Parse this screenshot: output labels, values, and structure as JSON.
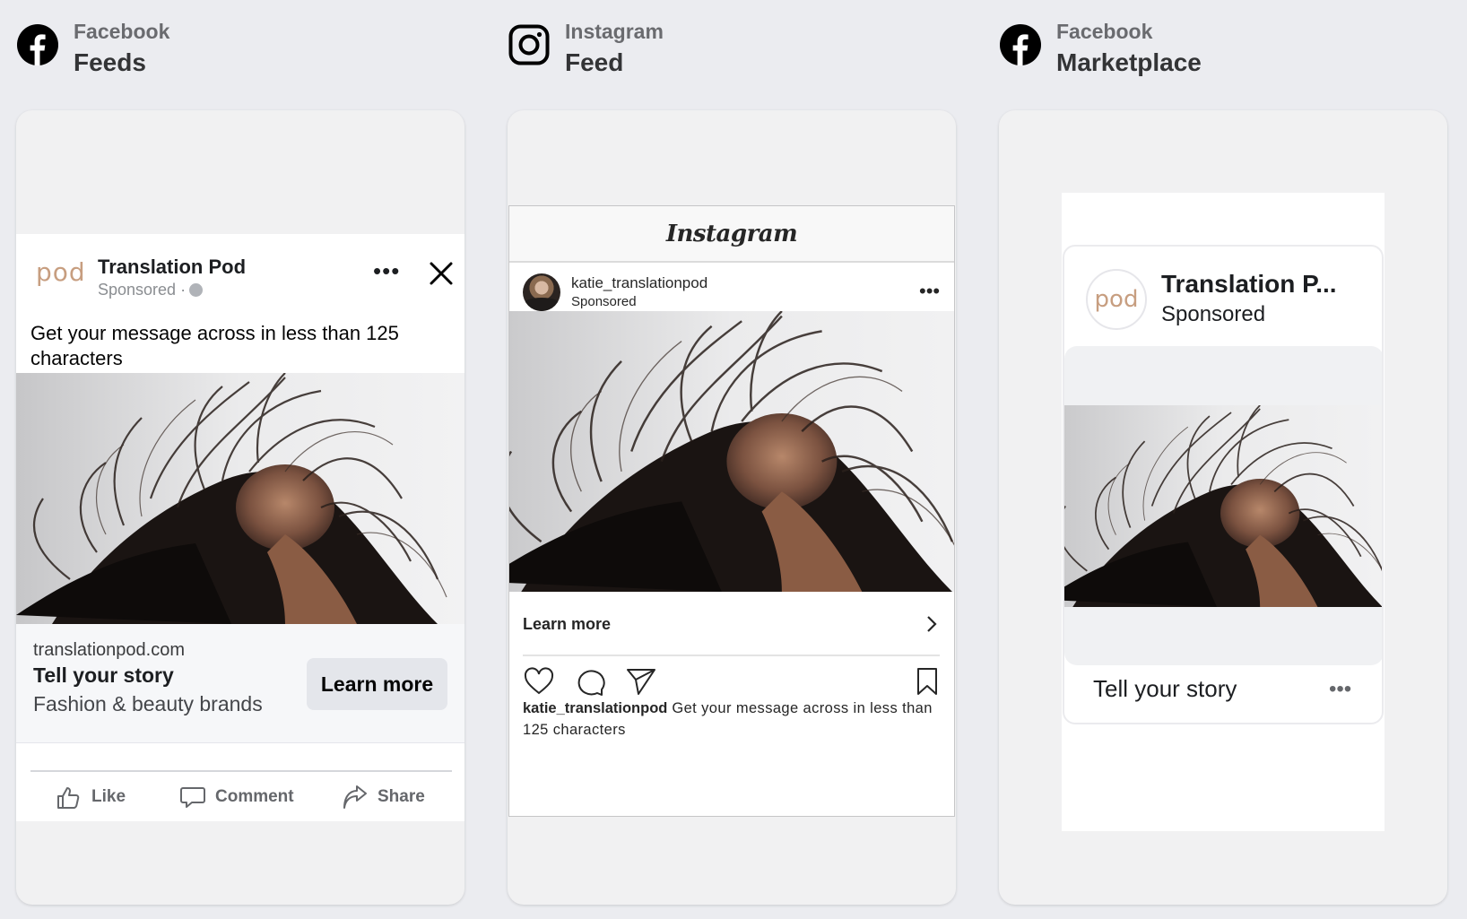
{
  "columns": [
    {
      "platform": "Facebook",
      "placement": "Feeds",
      "platform_icon": "facebook-icon"
    },
    {
      "platform": "Instagram",
      "placement": "Feed",
      "platform_icon": "instagram-icon"
    },
    {
      "platform": "Facebook",
      "placement": "Marketplace",
      "platform_icon": "facebook-icon"
    }
  ],
  "facebook_feed": {
    "logo_text": "pod",
    "page_name": "Translation Pod",
    "sponsored": "Sponsored ·",
    "more_icon": "more-horizontal-icon",
    "close_icon": "close-icon",
    "primary_text": "Get your message across in less than 125 characters",
    "image_alt": "Woman flipping long dark hair",
    "link_domain": "translationpod.com",
    "headline": "Tell your story",
    "description": "Fashion & beauty brands",
    "cta_label": "Learn more",
    "actions": [
      {
        "label": "Like",
        "icon": "thumbs-up-icon"
      },
      {
        "label": "Comment",
        "icon": "comment-icon"
      },
      {
        "label": "Share",
        "icon": "share-icon"
      }
    ]
  },
  "instagram_feed": {
    "wordmark": "Instagram",
    "username": "katie_translationpod",
    "sponsored": "Sponsored",
    "more_glyph": "•••",
    "cta_label": "Learn more",
    "caption_user": "katie_translationpod",
    "caption_text": "Get your message across in less than 125 characters"
  },
  "marketplace": {
    "logo_text": "pod",
    "page_name": "Translation P...",
    "sponsored": "Sponsored",
    "headline": "Tell your story",
    "more_glyph": "•••"
  },
  "colors": {
    "page_background": "#ebecf0",
    "card_background": "#f1f1f2",
    "brand_logo": "#c79e80",
    "cta_background": "#e4e6eb"
  }
}
